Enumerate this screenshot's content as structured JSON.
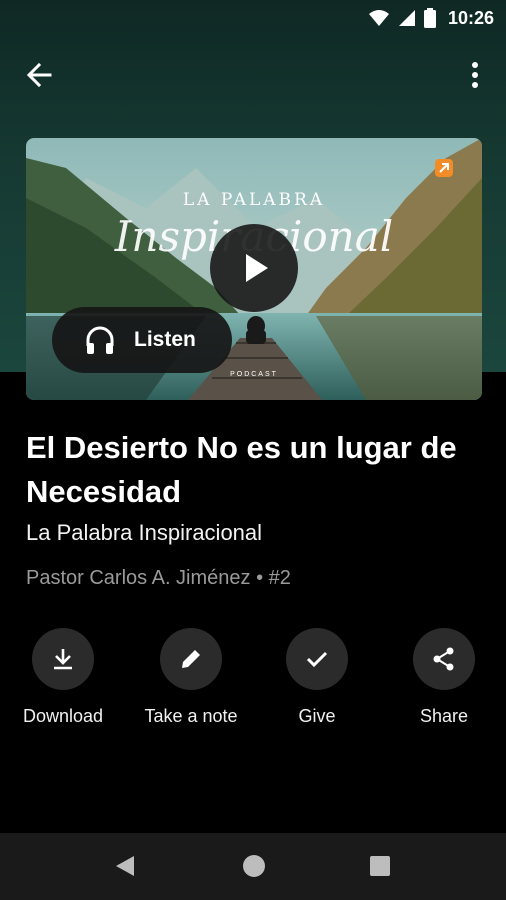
{
  "status_bar": {
    "time": "10:26"
  },
  "artwork": {
    "title_line1": "LA PALABRA",
    "title_line2": "Inspiracional",
    "tag": "PODCAST"
  },
  "player": {
    "listen_label": "Listen"
  },
  "episode": {
    "title": "El Desierto No es un lugar de Necesidad",
    "series": "La Palabra Inspiracional",
    "meta": "Pastor Carlos A. Jiménez • #2"
  },
  "actions": [
    {
      "label": "Download",
      "icon": "download-icon"
    },
    {
      "label": "Take a note",
      "icon": "pencil-icon"
    },
    {
      "label": "Give",
      "icon": "check-icon"
    },
    {
      "label": "Share",
      "icon": "share-icon"
    }
  ],
  "colors": {
    "background": "#000000",
    "header_gradient": "#1b463d",
    "action_circle": "#2b2b2b",
    "nav_bar": "#1a1a1a",
    "badge": "#f28c28"
  }
}
